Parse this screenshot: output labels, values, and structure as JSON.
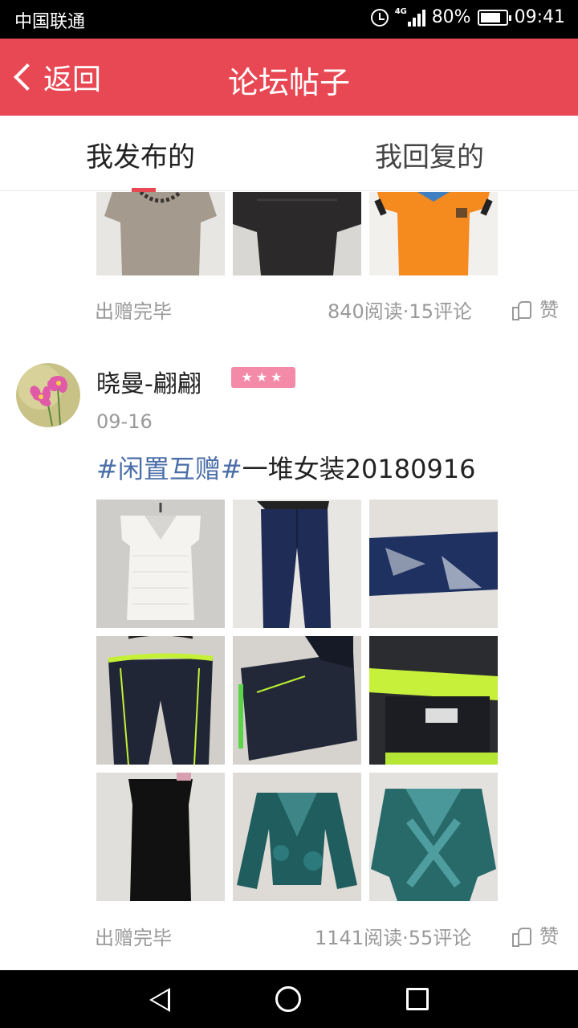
{
  "status_bar": {
    "carrier": "中国联通",
    "network": "4G",
    "battery": "80%",
    "time": "09:41"
  },
  "nav": {
    "back_label": "返回",
    "title": "论坛帖子"
  },
  "tabs": [
    {
      "label": "我发布的",
      "active": true
    },
    {
      "label": "我回复的",
      "active": false
    }
  ],
  "posts": [
    {
      "status": "出赠完毕",
      "stats": "840阅读·15评论",
      "like_label": "赞",
      "images": [
        "taupe-top",
        "black-top",
        "orange-polo"
      ]
    },
    {
      "author": "晓曼-翩翩",
      "level_badge": "★★★",
      "date": "09-16",
      "title_topic": "#闲置互赠#",
      "title_text": "一堆女装20180916",
      "status": "出赠完毕",
      "stats": "1141阅读·55评论",
      "like_label": "赞",
      "images": [
        "white-lace-top",
        "blue-jeans",
        "jeans-hem",
        "navy-shorts",
        "folded-shorts",
        "shorts-waistband",
        "black-dress",
        "teal-velvet-cardigan",
        "teal-velvet-top"
      ]
    }
  ],
  "colors": {
    "accent": "#e84853",
    "topic_link": "#4a6ea8",
    "badge": "#f28aa8"
  }
}
